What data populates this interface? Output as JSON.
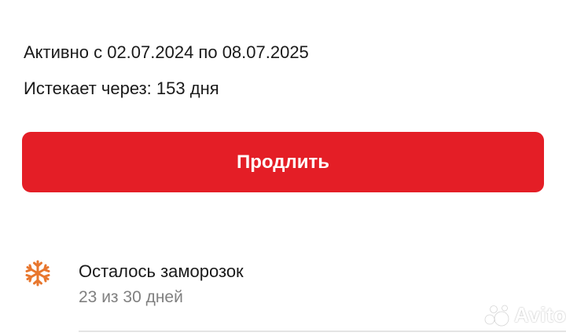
{
  "subscription": {
    "active_period": "Активно с 02.07.2024 по 08.07.2025",
    "expires_in": "Истекает через: 153 дня"
  },
  "actions": {
    "extend_label": "Продлить"
  },
  "freezes": {
    "title": "Осталось заморозок",
    "remaining": "23 из 30 дней",
    "icon": "snowflake-icon"
  },
  "watermark": {
    "text": "Avito"
  },
  "colors": {
    "accent": "#e41e26",
    "snowflake": "#e8772e",
    "primary_text": "#1a1a1a",
    "secondary_text": "#808080"
  }
}
